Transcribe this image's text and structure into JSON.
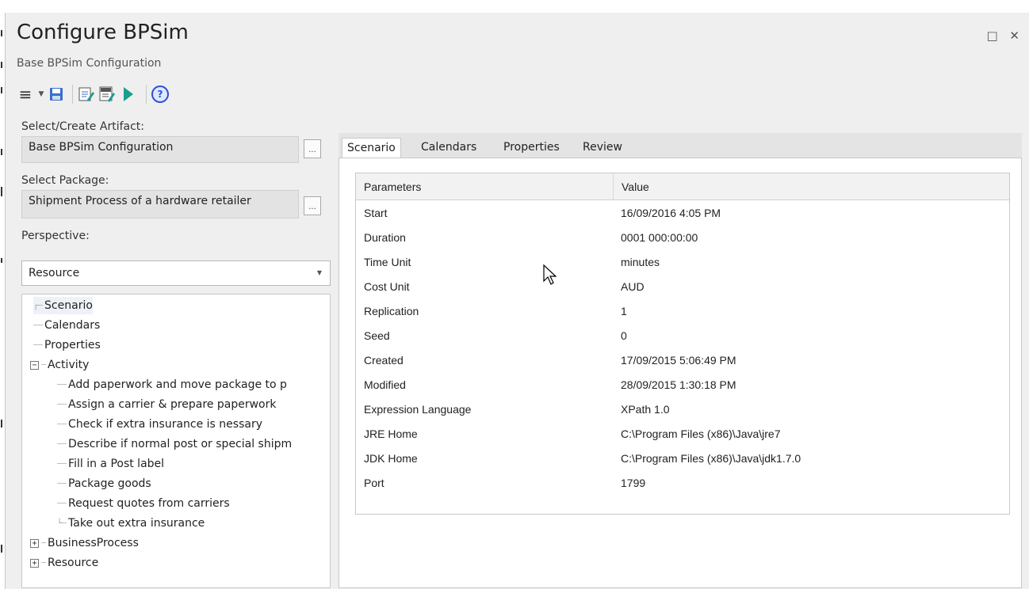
{
  "window": {
    "title": "Configure BPSim",
    "subtitle": "Base BPSim Configuration",
    "restore_glyph": "□",
    "close_glyph": "✕"
  },
  "toolbar": {
    "icons": [
      "menu-icon",
      "dropdown-caret-icon",
      "save-icon",
      "edit-document-icon",
      "xml-export-icon",
      "run-icon",
      "help-icon"
    ],
    "help_glyph": "?"
  },
  "left": {
    "artifact_label": "Select/Create Artifact:",
    "artifact_value": "Base BPSim Configuration",
    "package_label": "Select Package:",
    "package_value": "Shipment Process of a hardware retailer",
    "browse_label": "...",
    "perspective_label": "Perspective:",
    "perspective_value": "Resource",
    "perspective_arrow": "▼"
  },
  "tree": {
    "expanded_glyph": "−",
    "collapsed_glyph": "+",
    "items": [
      {
        "label": "Scenario"
      },
      {
        "label": "Calendars"
      },
      {
        "label": "Properties"
      },
      {
        "label": "Activity"
      },
      {
        "label": "Add paperwork and move package to p"
      },
      {
        "label": "Assign a carrier & prepare paperwork"
      },
      {
        "label": "Check if extra insurance is nessary"
      },
      {
        "label": "Describe if normal post or special shipm"
      },
      {
        "label": "Fill in a Post label"
      },
      {
        "label": "Package goods"
      },
      {
        "label": "Request quotes from carriers"
      },
      {
        "label": "Take out extra insurance"
      },
      {
        "label": "BusinessProcess"
      },
      {
        "label": "Resource"
      }
    ]
  },
  "tabs": [
    "Scenario",
    "Calendars",
    "Properties",
    "Review"
  ],
  "grid": {
    "headers": [
      "Parameters",
      "Value"
    ],
    "rows": [
      [
        "Start",
        "16/09/2016 4:05 PM"
      ],
      [
        "Duration",
        "0001 000:00:00"
      ],
      [
        "Time Unit",
        "minutes"
      ],
      [
        "Cost Unit",
        "AUD"
      ],
      [
        "Replication",
        "1"
      ],
      [
        "Seed",
        "0"
      ],
      [
        "Created",
        "17/09/2015 5:06:49 PM"
      ],
      [
        "Modified",
        "28/09/2015 1:30:18 PM"
      ],
      [
        "Expression Language",
        "XPath 1.0"
      ],
      [
        "JRE Home",
        "C:\\Program Files (x86)\\Java\\jre7"
      ],
      [
        "JDK Home",
        "C:\\Program Files (x86)\\Java\\jdk1.7.0"
      ],
      [
        "Port",
        "1799"
      ]
    ]
  },
  "colors": {
    "accent_teal": "#1a9e8f",
    "help_blue": "#2a4fd4",
    "save_blue": "#3a6fc8"
  }
}
